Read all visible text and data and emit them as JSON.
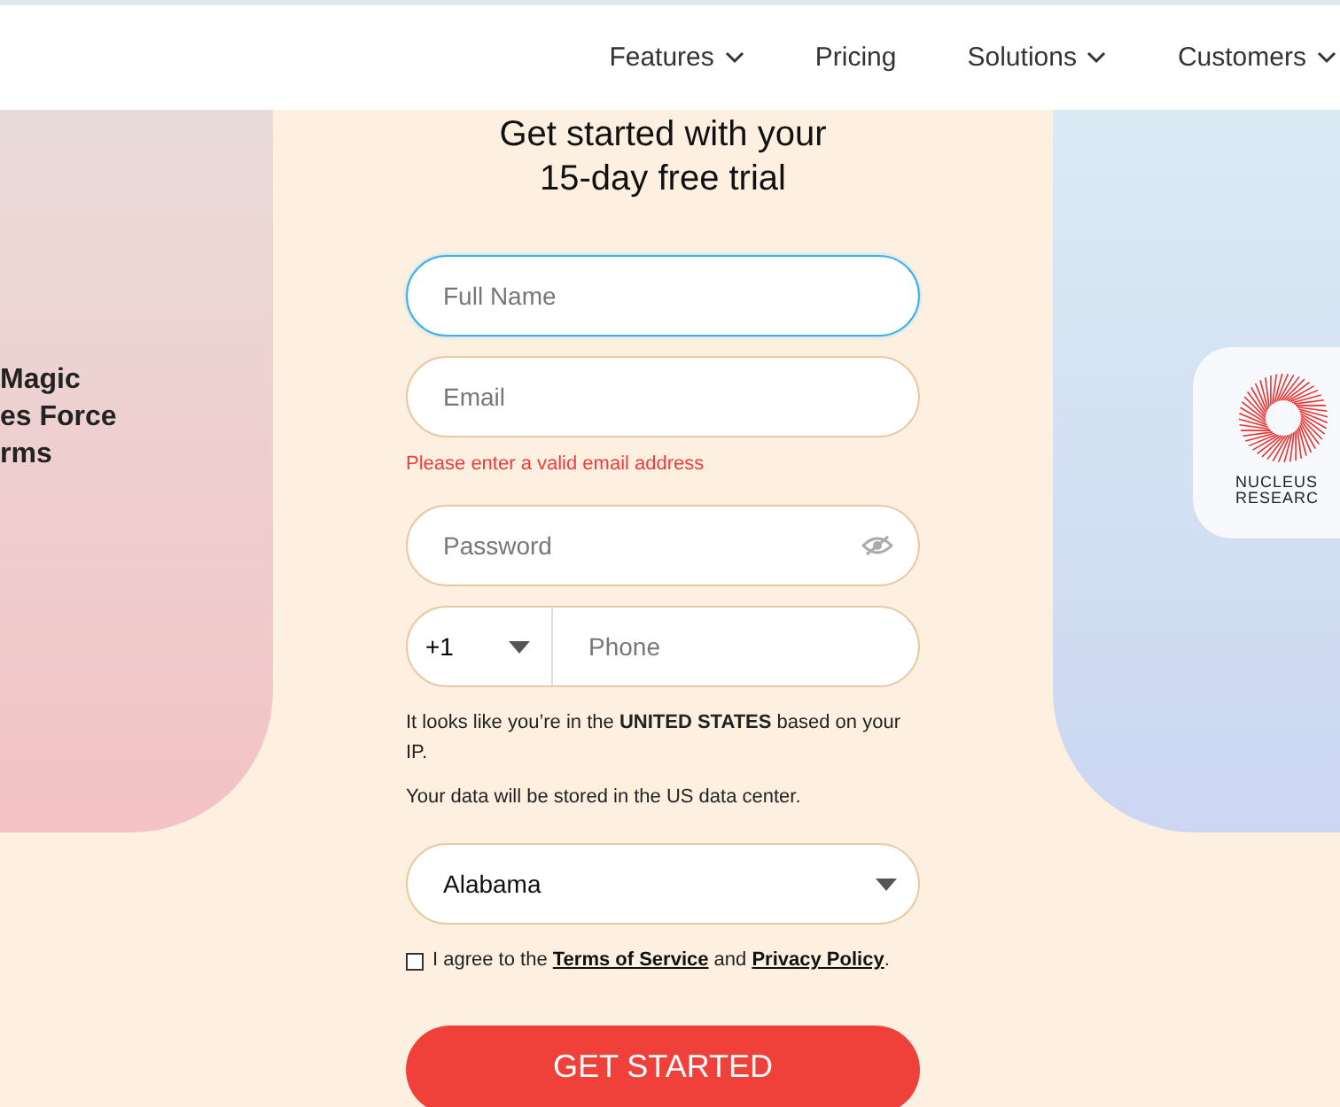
{
  "nav": {
    "items": [
      {
        "label": "Features",
        "dropdown": true
      },
      {
        "label": "Pricing",
        "dropdown": false
      },
      {
        "label": "Solutions",
        "dropdown": true
      },
      {
        "label": "Customers",
        "dropdown": true
      }
    ]
  },
  "left_panel": {
    "heading_lines": [
      "Magic",
      "es Force",
      "rms"
    ]
  },
  "right_panel": {
    "logo_lines": [
      "NUCLEUS",
      "RESEARC"
    ]
  },
  "form": {
    "title_lines": [
      "Get started with your",
      "15-day free trial"
    ],
    "fields": [
      {
        "kind": "text",
        "placeholder": "Full Name",
        "focused": true
      },
      {
        "kind": "email",
        "placeholder": "Email",
        "focused": false,
        "error": "Please enter a valid email address"
      },
      {
        "kind": "password",
        "placeholder": "Password",
        "focused": false
      },
      {
        "kind": "phone",
        "code": "+1",
        "placeholder": "Phone",
        "focused": false
      }
    ],
    "location_note": "It looks like you’re in the **UNITED STATES** based on your IP.",
    "data_note": "Your data will be stored in the US data center.",
    "region": {
      "value": "Alabama"
    },
    "agree": {
      "checked": false,
      "prefix": "I agree to the",
      "terms": "Terms of Service",
      "middle": "and",
      "privacy": "Privacy Policy",
      "suffix": "."
    },
    "submit": "GET STARTED"
  }
}
